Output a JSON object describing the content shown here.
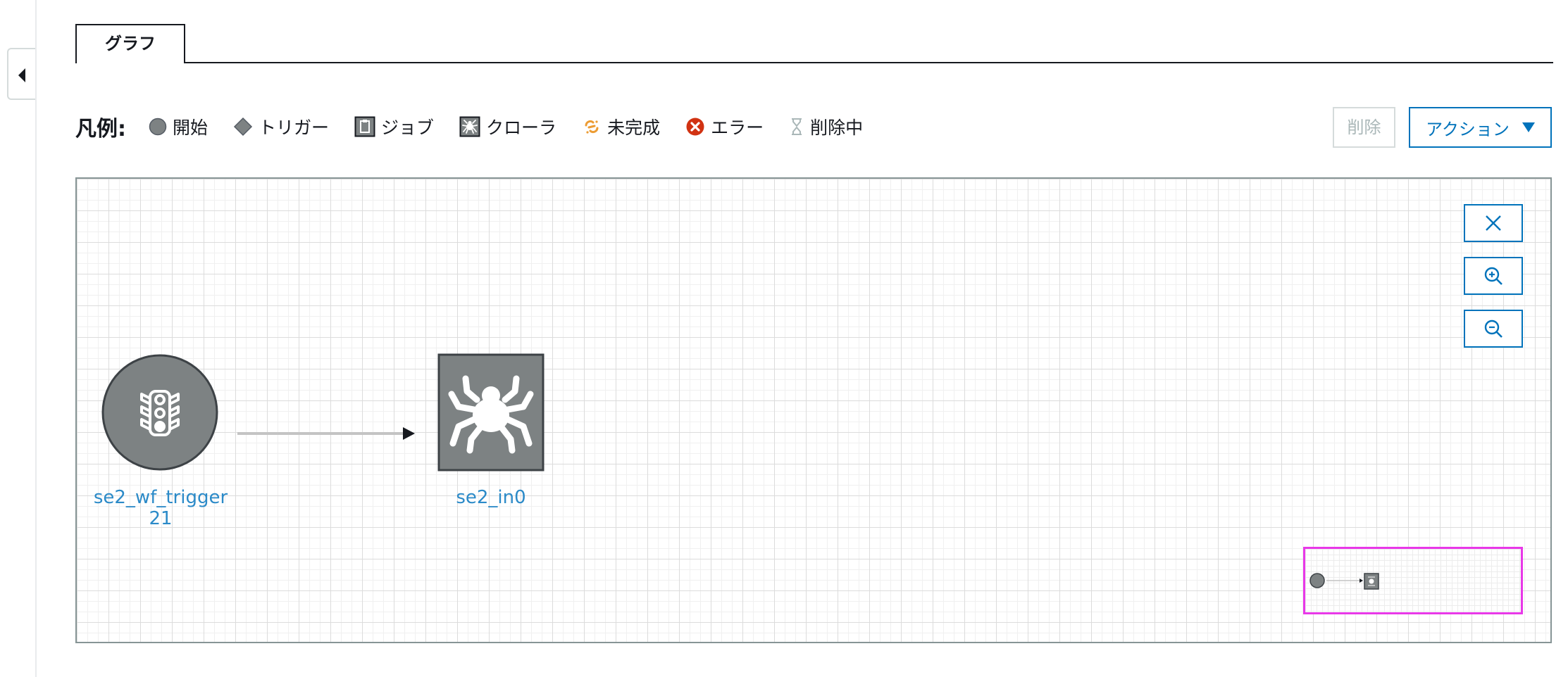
{
  "tabs": [
    {
      "label": "グラフ",
      "active": true
    }
  ],
  "legend": {
    "title": "凡例:",
    "items": [
      {
        "icon": "start-circle-icon",
        "label": "開始"
      },
      {
        "icon": "trigger-diamond-icon",
        "label": "トリガー"
      },
      {
        "icon": "job-clipboard-icon",
        "label": "ジョブ"
      },
      {
        "icon": "crawler-spider-icon",
        "label": "クローラ"
      },
      {
        "icon": "incomplete-icon",
        "label": "未完成"
      },
      {
        "icon": "error-icon",
        "label": "エラー"
      },
      {
        "icon": "hourglass-icon",
        "label": "削除中"
      }
    ]
  },
  "toolbar": {
    "delete_label": "削除",
    "action_label": "アクション",
    "delete_disabled": true
  },
  "graph": {
    "nodes": [
      {
        "id": "trigger",
        "type": "trigger",
        "label_line1": "se2_wf_trigger",
        "label_line2": "21"
      },
      {
        "id": "crawler",
        "type": "crawler",
        "label_line1": "se2_in0"
      }
    ],
    "edges": [
      {
        "from": "trigger",
        "to": "crawler"
      }
    ],
    "controls": [
      "reset-view",
      "zoom-in",
      "zoom-out"
    ]
  },
  "colors": {
    "accent": "#0073bb",
    "node_link": "#2b8ac8",
    "node_fill": "#7d8283",
    "incomplete": "#ec9c34",
    "error": "#d13212",
    "minimap_border": "#e838e8"
  }
}
